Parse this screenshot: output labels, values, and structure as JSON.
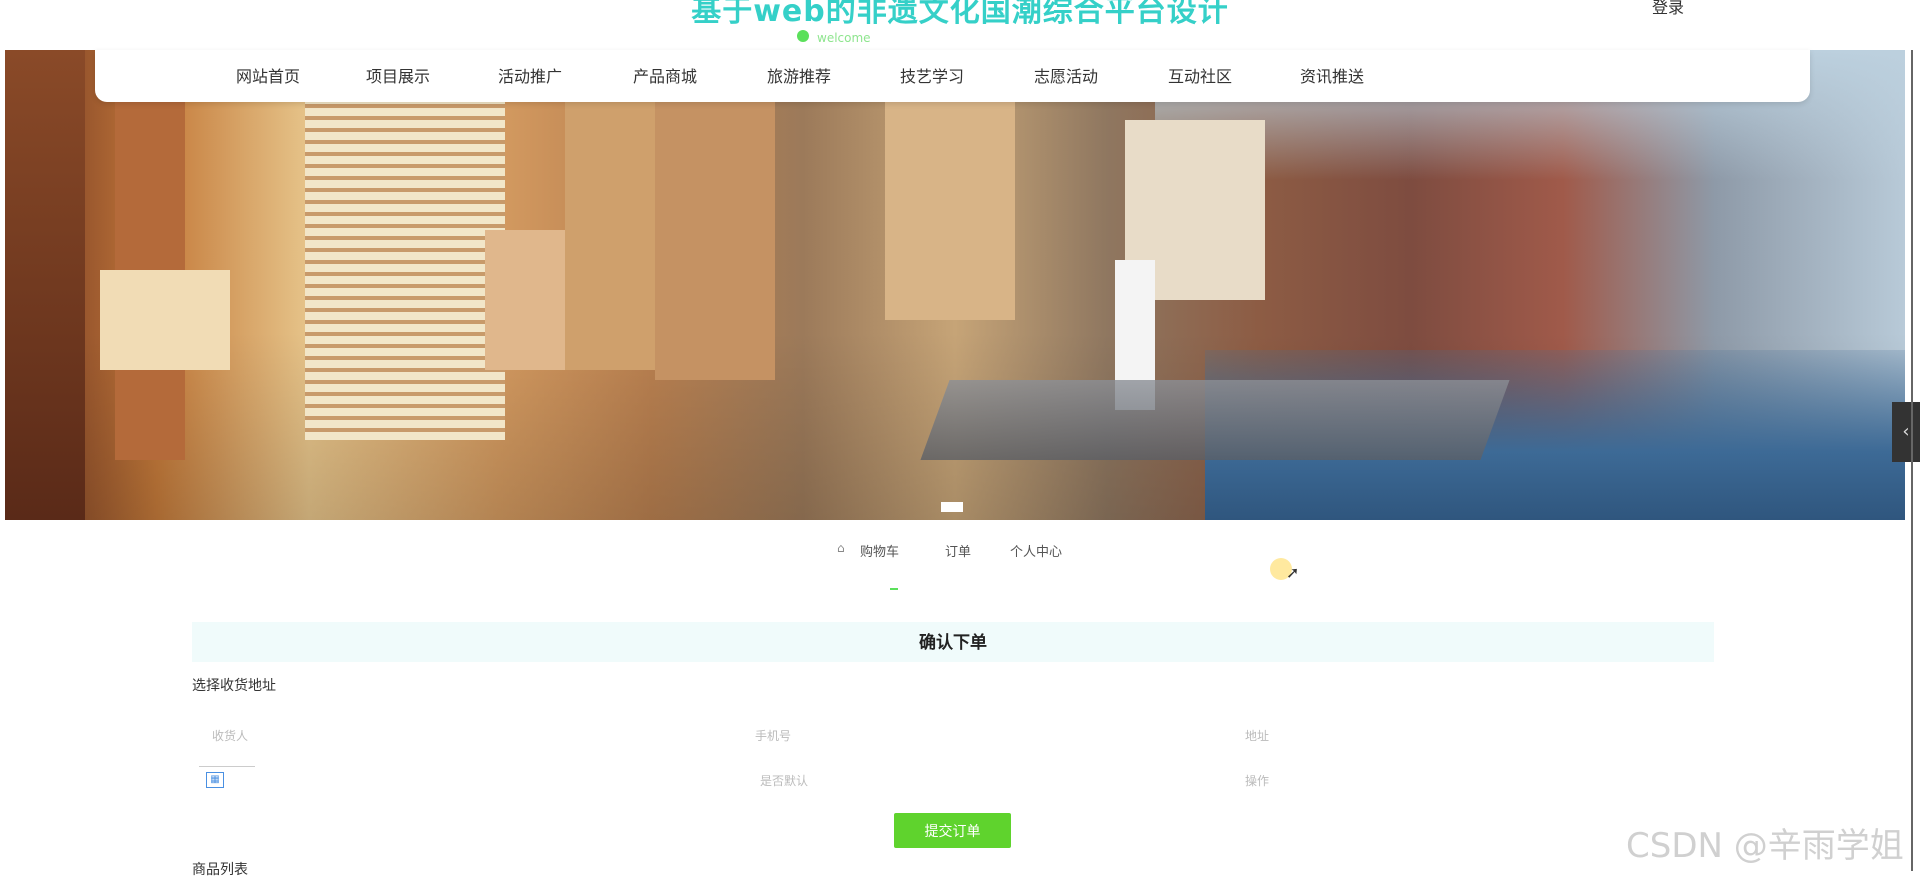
{
  "header": {
    "site_title": "基于web的非遗文化国潮综合平台设计",
    "top_right_link": "登录",
    "status_text": "welcome"
  },
  "nav": {
    "items": [
      {
        "label": "网站首页"
      },
      {
        "label": "项目展示"
      },
      {
        "label": "活动推广"
      },
      {
        "label": "产品商城"
      },
      {
        "label": "旅游推荐"
      },
      {
        "label": "技艺学习"
      },
      {
        "label": "志愿活动"
      },
      {
        "label": "互动社区"
      },
      {
        "label": "资讯推送"
      }
    ]
  },
  "breadcrumb": {
    "items": [
      "购物车",
      "订单",
      "个人中心"
    ]
  },
  "order": {
    "confirm_title": "确认下单",
    "select_address_label": "选择收货地址",
    "address_row1": [
      "收货人",
      "手机号",
      "地址"
    ],
    "address_row2": [
      "",
      "是否默认",
      "操作"
    ],
    "submit_label": "提交订单",
    "list_label": "商品列表"
  },
  "watermark": "CSDN @辛雨学姐",
  "icons": [
    "chevron-left-icon",
    "cursor-icon",
    "address-edit-icon"
  ]
}
